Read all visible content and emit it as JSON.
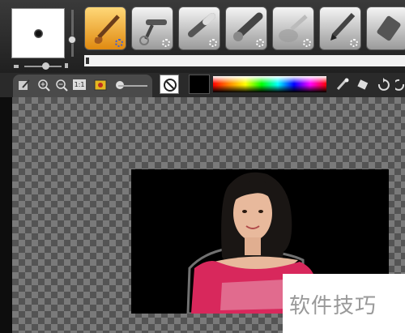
{
  "brush_panel": {
    "preview_icon": "brush-tip-preview"
  },
  "tools": [
    {
      "name": "paintbrush",
      "active": true
    },
    {
      "name": "airbrush",
      "active": false
    },
    {
      "name": "chalk",
      "active": false
    },
    {
      "name": "marker",
      "active": false
    },
    {
      "name": "blur",
      "active": false
    },
    {
      "name": "pencil",
      "active": false
    },
    {
      "name": "eraser",
      "active": false
    }
  ],
  "view_toolbar": {
    "actual_size_label": "1:1",
    "icons": [
      "edit-icon",
      "zoom-in-icon",
      "zoom-out-icon",
      "actual-size-icon",
      "picture-icon"
    ]
  },
  "color_bar": {
    "fill_color": "#000000",
    "right_icons": [
      "color-picker-icon",
      "fill-icon",
      "undo-icon",
      "redo-icon"
    ]
  },
  "watermark": {
    "text": "软件技巧"
  },
  "colors": {
    "active_tool": "#f0a020",
    "canvas_checker": "#6b6b6b"
  }
}
